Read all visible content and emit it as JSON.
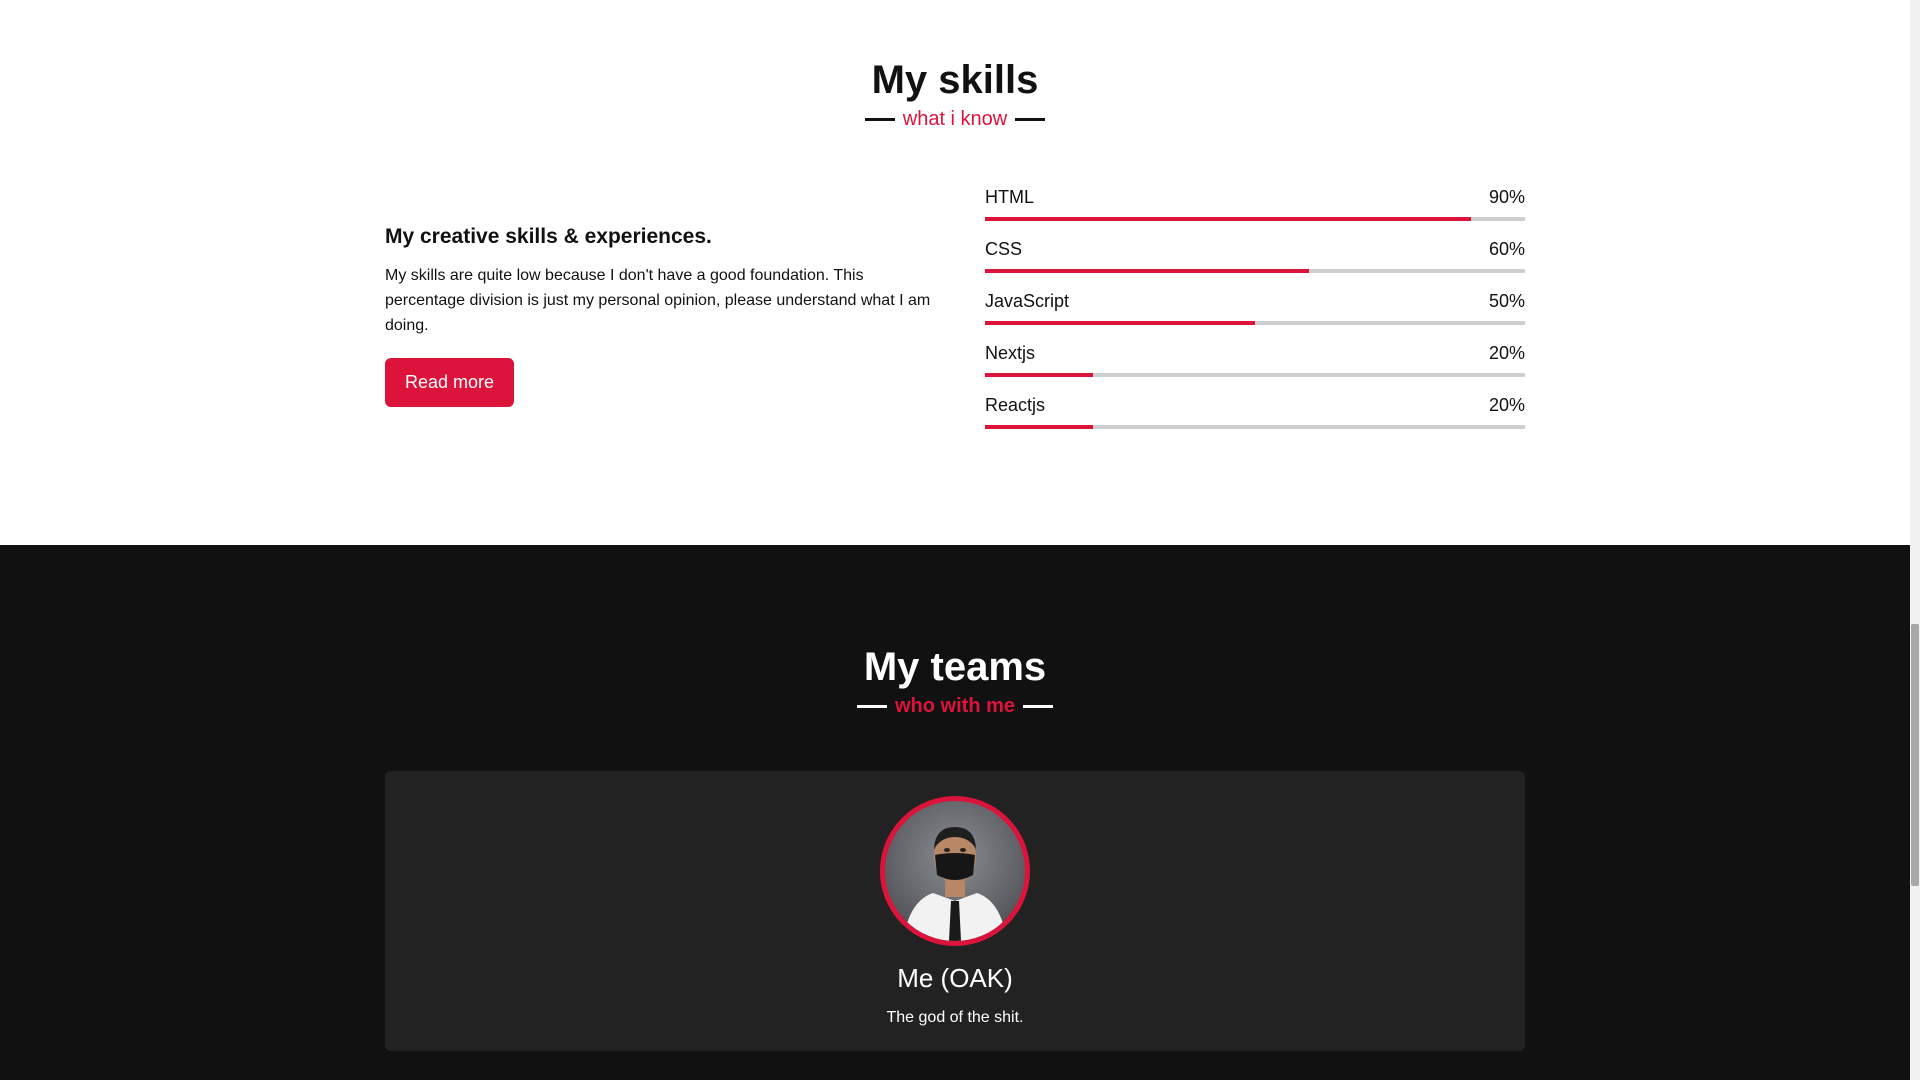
{
  "skills_section": {
    "title": "My skills",
    "subtitle": "what i know",
    "heading": "My creative skills & experiences.",
    "paragraph": "My skills are quite low because I don't have a good foundation. This percentage division is just my personal opinion, please understand what I am doing.",
    "button_label": "Read more",
    "skills": [
      {
        "name": "HTML",
        "percent_label": "90%",
        "percent": 90
      },
      {
        "name": "CSS",
        "percent_label": "60%",
        "percent": 60
      },
      {
        "name": "JavaScript",
        "percent_label": "50%",
        "percent": 50
      },
      {
        "name": "Nextjs",
        "percent_label": "20%",
        "percent": 20
      },
      {
        "name": "Reactjs",
        "percent_label": "20%",
        "percent": 20
      }
    ]
  },
  "teams_section": {
    "title": "My teams",
    "subtitle": "who with me",
    "member": {
      "name": "Me (OAK)",
      "role": "The god of the shit."
    }
  },
  "colors": {
    "accent": "#dc143c",
    "dark_bg": "#111111",
    "card_bg": "#222222",
    "track": "#cfcfcf"
  }
}
